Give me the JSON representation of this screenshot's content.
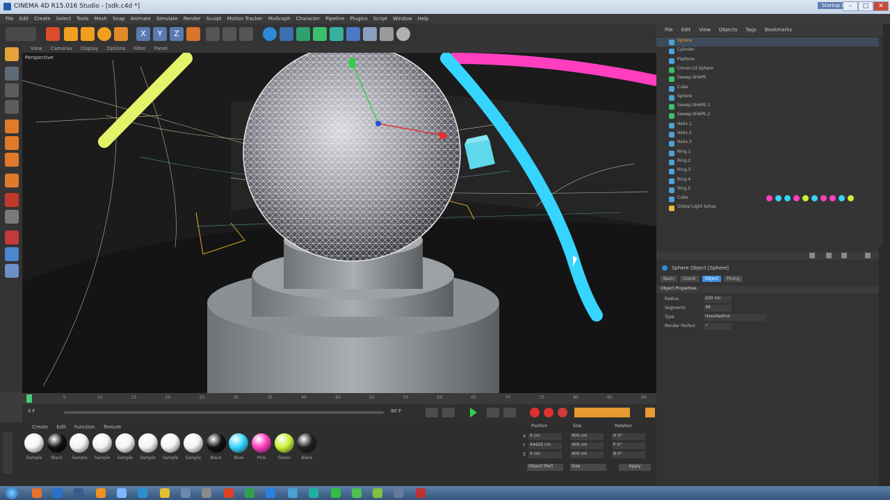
{
  "app": {
    "title": "CINEMA 4D R15.016 Studio - [sdk.c4d *]"
  },
  "titlebar": {
    "layout_label": "Startup Layout",
    "min": "–",
    "max": "□",
    "close": "✕"
  },
  "menubar": {
    "items": [
      "File",
      "Edit",
      "Create",
      "Select",
      "Tools",
      "Mesh",
      "Snap",
      "Animate",
      "Simulate",
      "Render",
      "Sculpt",
      "Motion Tracker",
      "MoGraph",
      "Character",
      "Pipeline",
      "Plugins",
      "Script",
      "Window",
      "Help"
    ]
  },
  "viewport": {
    "menu": [
      "View",
      "Cameras",
      "Display",
      "Options",
      "Filter",
      "Panel"
    ],
    "label": "Perspective"
  },
  "timeline": {
    "frame_start": "0 F",
    "frame_end": "90 F",
    "ticks": [
      "0",
      "5",
      "10",
      "15",
      "20",
      "25",
      "30",
      "35",
      "40",
      "45",
      "50",
      "55",
      "60",
      "65",
      "70",
      "75",
      "80",
      "85",
      "90"
    ]
  },
  "materials": {
    "menu": [
      "Create",
      "Edit",
      "Function",
      "Texture"
    ],
    "items": [
      {
        "label": "Sample",
        "color": "#f4f4f4"
      },
      {
        "label": "Black",
        "color": "#111111"
      },
      {
        "label": "Sample",
        "color": "#f4f4f4"
      },
      {
        "label": "Sample",
        "color": "#f4f4f4"
      },
      {
        "label": "Sample",
        "color": "#f4f4f4"
      },
      {
        "label": "Sample",
        "color": "#f4f4f4"
      },
      {
        "label": "Sample",
        "color": "#f4f4f4"
      },
      {
        "label": "Sample",
        "color": "#f4f4f4"
      },
      {
        "label": "Black",
        "color": "#111111"
      },
      {
        "label": "Blue",
        "color": "#35d5ff"
      },
      {
        "label": "Pink",
        "color": "#ff3fc0"
      },
      {
        "label": "Green",
        "color": "#c8f03a"
      },
      {
        "label": "Black",
        "color": "#222222"
      }
    ]
  },
  "coords": {
    "headers": [
      "Position",
      "Size",
      "Rotation"
    ],
    "rows": [
      {
        "axis": "X",
        "pos": "0 cm",
        "size": "400 cm",
        "rot": "H 0°"
      },
      {
        "axis": "Y",
        "pos": "44425 cm",
        "size": "400 cm",
        "rot": "P 0°"
      },
      {
        "axis": "Z",
        "pos": "0 cm",
        "size": "400 cm",
        "rot": "B 0°"
      }
    ],
    "mode": "Object (Rel)",
    "size_mode": "Size",
    "apply": "Apply"
  },
  "object_manager": {
    "menu": [
      "File",
      "Edit",
      "View",
      "Objects",
      "Tags",
      "Bookmarks"
    ],
    "objects": [
      "Sphere",
      "Cylinder",
      "Platform",
      "Cloner.Cd Sphere",
      "Sweep.SHAPE",
      "Cube",
      "Sphere",
      "Sweep.SHAPE.1",
      "Sweep.SHAPE.2",
      "Helix.1",
      "Helix.2",
      "Helix.3",
      "Ring.1",
      "Ring.2",
      "Ring.3",
      "Ring.4",
      "Ring.5",
      "Cube",
      "Global Light Setup"
    ]
  },
  "attributes": {
    "header": "Sphere Object [Sphere]",
    "tabs": [
      "Basic",
      "Coord.",
      "Object",
      "Phong"
    ],
    "active_tab": "Object",
    "section": "Object Properties",
    "fields": [
      {
        "label": "Radius",
        "value": "200 cm"
      },
      {
        "label": "Segments",
        "value": "48"
      },
      {
        "label": "Type",
        "value": "Hexahedron"
      },
      {
        "label": "Render Perfect",
        "value": "✓"
      }
    ]
  },
  "colors": {
    "accent": "#4da3d8",
    "blue_tube": "#35d5ff",
    "pink_tube": "#ff3fc0",
    "yellow_tube": "#e4f46a"
  }
}
